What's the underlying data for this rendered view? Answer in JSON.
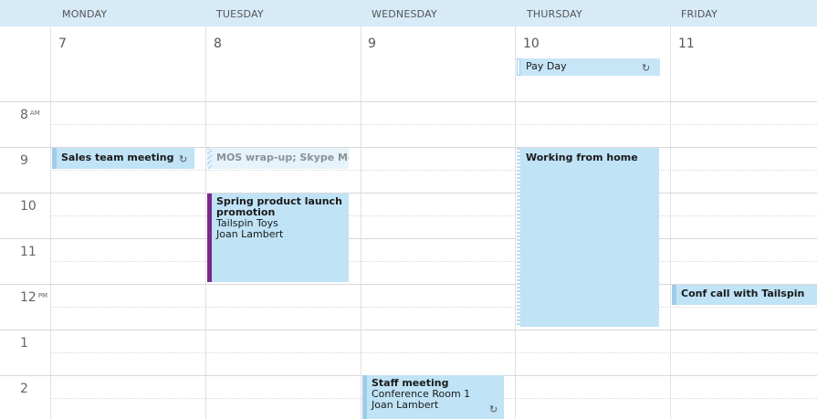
{
  "days": [
    {
      "name": "MONDAY",
      "num": "7"
    },
    {
      "name": "TUESDAY",
      "num": "8"
    },
    {
      "name": "WEDNESDAY",
      "num": "9"
    },
    {
      "name": "THURSDAY",
      "num": "10"
    },
    {
      "name": "FRIDAY",
      "num": "11"
    }
  ],
  "hours": [
    {
      "num": "8",
      "suffix": "AM"
    },
    {
      "num": "9",
      "suffix": ""
    },
    {
      "num": "10",
      "suffix": ""
    },
    {
      "num": "11",
      "suffix": ""
    },
    {
      "num": "12",
      "suffix": "PM"
    },
    {
      "num": "1",
      "suffix": ""
    },
    {
      "num": "2",
      "suffix": ""
    }
  ],
  "events": {
    "payday": {
      "title": "Pay Day",
      "icon": "recurring-icon"
    },
    "sales": {
      "title": "Sales team meeting",
      "icon": "recurring-icon"
    },
    "mos": {
      "title": "MOS wrap-up; Skype Mee"
    },
    "spring": {
      "title": "Spring product launch promotion",
      "line1": "Tailspin Toys",
      "line2": "Joan Lambert",
      "accent": "#7b2a8b"
    },
    "home": {
      "title": "Working from home"
    },
    "conf": {
      "title": "Conf call with Tailspin"
    },
    "staff": {
      "title": "Staff meeting",
      "line1": "Conference Room 1",
      "line2": "Joan Lambert",
      "icon": "recurring-icon"
    }
  },
  "colors": {
    "header_bg": "#d6eaf8",
    "event_bg": "#c0e3f6",
    "event_bar": "#9fcde9"
  }
}
